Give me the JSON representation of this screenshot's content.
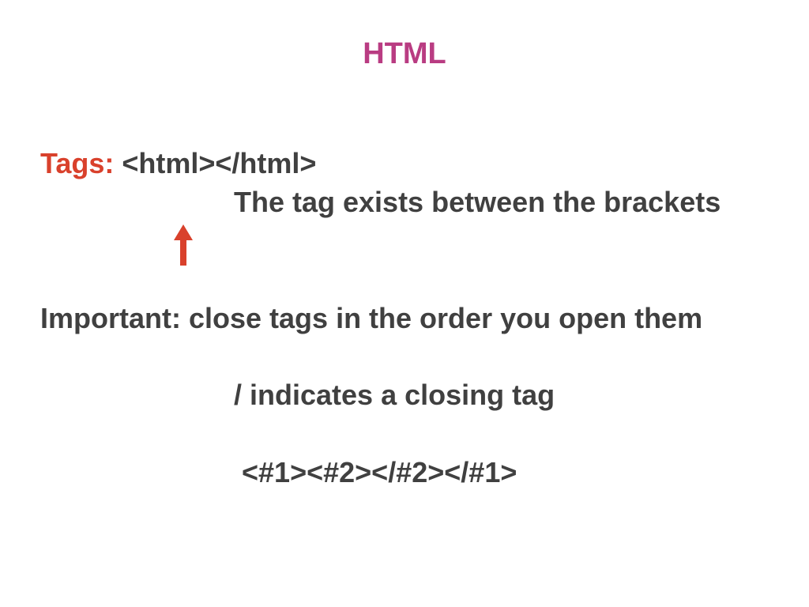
{
  "slide": {
    "title": "HTML",
    "tags_label": "Tags:",
    "tags_example": "<html></html>",
    "tags_explanation": "The tag exists between the brackets",
    "important_note": "Important: close tags in the order you open them",
    "closing_note": "/ indicates a closing tag",
    "nesting_example": "<#1><#2></#2></#1>",
    "arrow_icon": "up-arrow-icon",
    "colors": {
      "title": "#b93c82",
      "accent": "#d9412c",
      "text": "#404040"
    }
  }
}
